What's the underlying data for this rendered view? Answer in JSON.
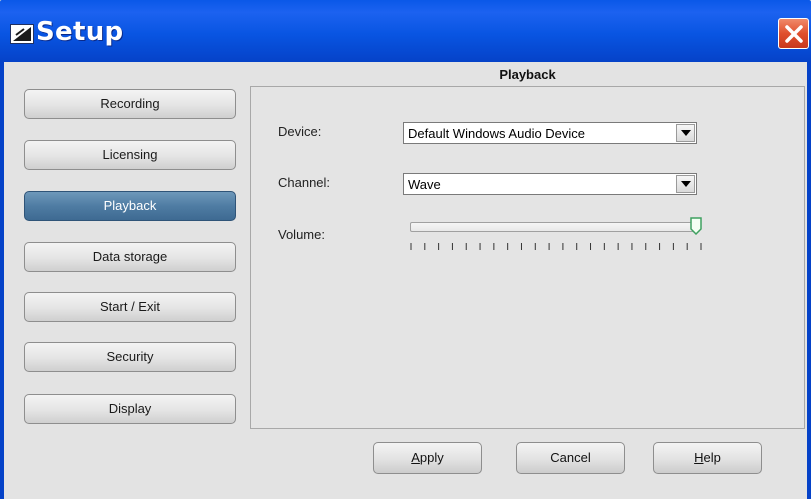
{
  "window": {
    "title": "Setup"
  },
  "nav": {
    "items": [
      {
        "label": "Recording",
        "active": false
      },
      {
        "label": "Licensing",
        "active": false
      },
      {
        "label": "Playback",
        "active": true
      },
      {
        "label": "Data storage",
        "active": false
      },
      {
        "label": "Start / Exit",
        "active": false
      },
      {
        "label": "Security",
        "active": false
      },
      {
        "label": "Display",
        "active": false
      }
    ]
  },
  "panel": {
    "title": "Playback",
    "device": {
      "label": "Device:",
      "value": "Default Windows Audio Device"
    },
    "channel": {
      "label": "Channel:",
      "value": "Wave"
    },
    "volume": {
      "label": "Volume:",
      "level": 1.0,
      "tick_count": 22
    }
  },
  "buttons": {
    "apply": {
      "mnemonic": "A",
      "rest": "pply"
    },
    "cancel": {
      "label": "Cancel"
    },
    "help": {
      "mnemonic": "H",
      "rest": "elp"
    }
  },
  "colors": {
    "titlebar": "#0955E2",
    "active_nav": "#4F7CA3",
    "close": "#E0502E",
    "thumb": "#3FA060"
  },
  "icons": [
    "setup-app-icon",
    "close-icon",
    "dropdown-arrow-icon",
    "slider-thumb-icon"
  ]
}
